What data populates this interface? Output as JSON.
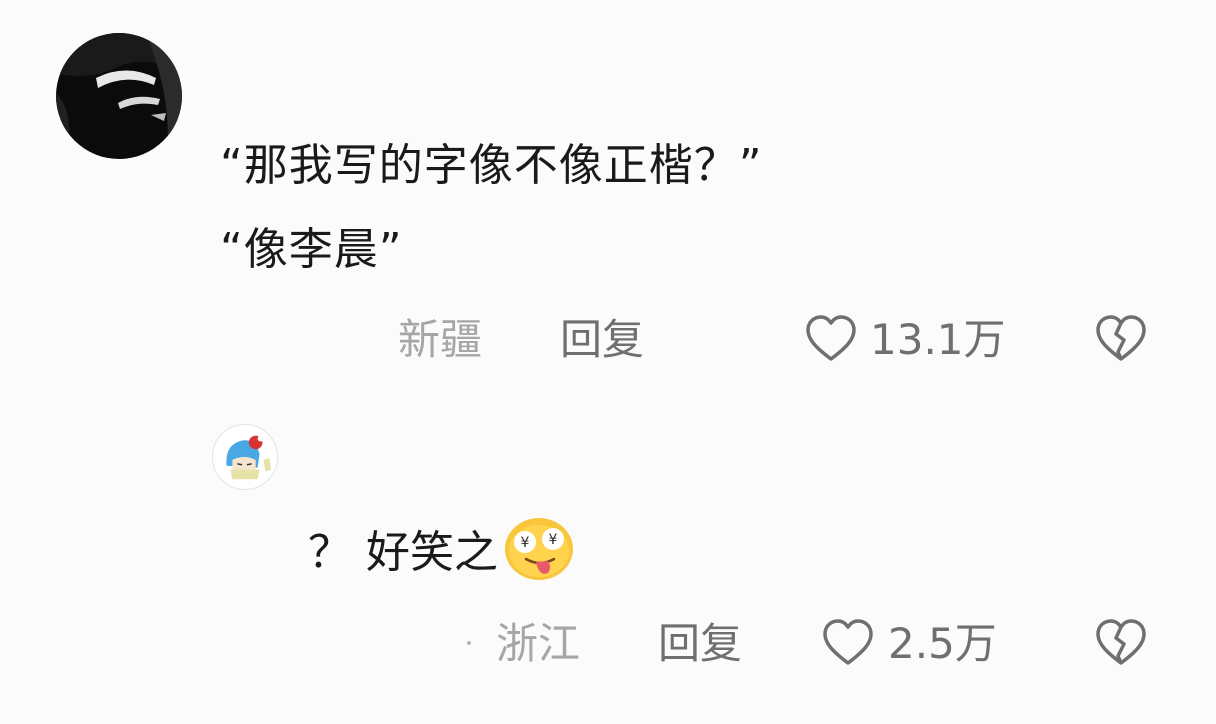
{
  "comment": {
    "lines": [
      "“那我写的字像不像正楷？”",
      "“像李晨”"
    ],
    "location": "新疆",
    "reply_label": "回复",
    "likes": "13.1万",
    "like_icon": "heart-outline-icon",
    "dislike_icon": "broken-heart-icon"
  },
  "reply": {
    "text": "？ 好笑之",
    "emoji": "money-eyes-tongue-emoji",
    "location": "浙江",
    "reply_label": "回复",
    "likes": "2.5万",
    "like_icon": "heart-outline-icon",
    "dislike_icon": "broken-heart-icon"
  },
  "colors": {
    "background": "#fbfbfb",
    "text": "#1a1a1a",
    "meta_text": "#6f6f6f",
    "location_text": "#a6a6a6"
  }
}
